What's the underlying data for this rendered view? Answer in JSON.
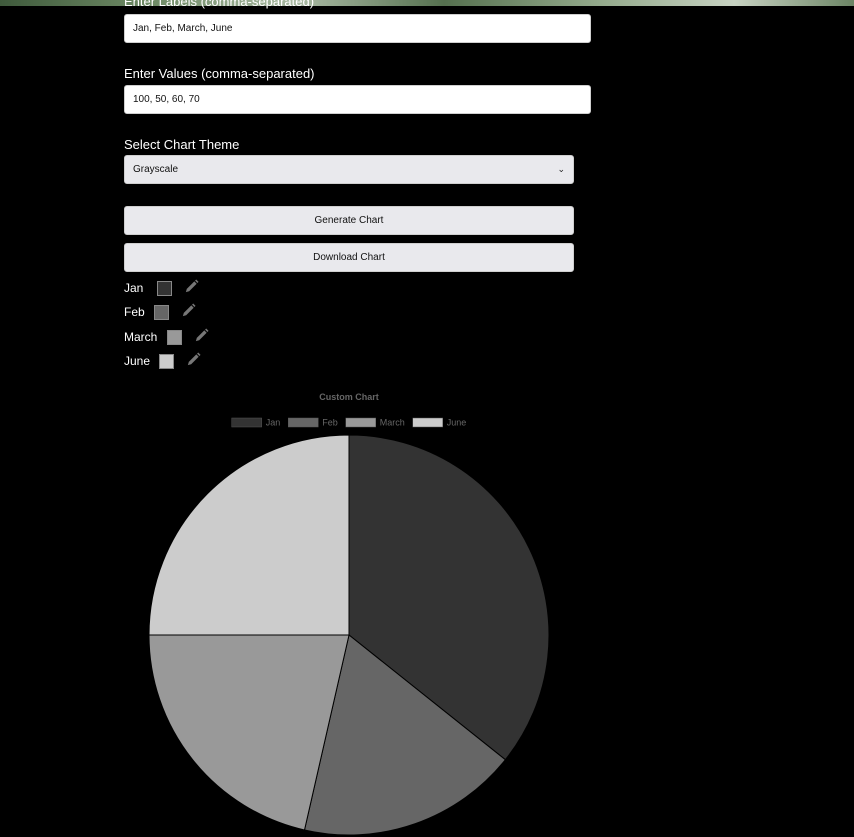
{
  "form": {
    "labels_label": "Enter Labels (comma-separated)",
    "labels_value": "Jan, Feb, March, June",
    "values_label": "Enter Values (comma-separated)",
    "values_value": "100, 50, 60, 70",
    "theme_label": "Select Chart Theme",
    "theme_selected": "Grayscale",
    "generate_button": "Generate Chart",
    "download_button": "Download Chart"
  },
  "color_pickers": [
    {
      "label": "Jan",
      "color": "#333333",
      "icon": "pencil-icon"
    },
    {
      "label": "Feb",
      "color": "#666666",
      "icon": "pencil-icon"
    },
    {
      "label": "March",
      "color": "#999999",
      "icon": "pencil-icon"
    },
    {
      "label": "June",
      "color": "#cccccc",
      "icon": "pencil-icon"
    }
  ],
  "chart_data": {
    "type": "pie",
    "title": "Custom Chart",
    "categories": [
      "Jan",
      "Feb",
      "March",
      "June"
    ],
    "values": [
      100,
      50,
      60,
      70
    ],
    "colors": [
      "#333333",
      "#666666",
      "#999999",
      "#cccccc"
    ],
    "legend_position": "top",
    "start_angle": "top, clockwise"
  }
}
